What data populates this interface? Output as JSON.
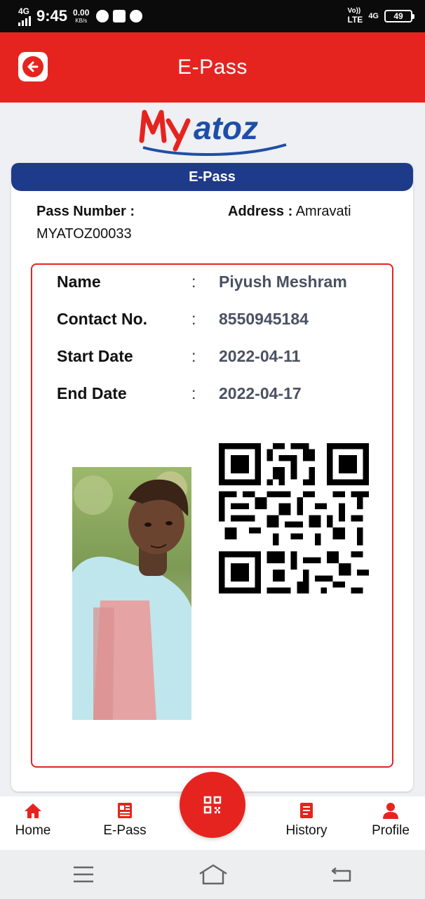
{
  "status_bar": {
    "network": "4G",
    "time": "9:45",
    "speed_value": "0.00",
    "speed_unit": "KB/s",
    "volte": "Vo))",
    "lte": "LTE",
    "signal_type": "4G",
    "battery": "49"
  },
  "app_bar": {
    "title": "E-Pass",
    "back_icon": "arrow-left-icon"
  },
  "logo": {
    "text_my": "MY",
    "text_atoz": "atoz",
    "brand_red": "#e52420",
    "brand_blue": "#1e4fa8"
  },
  "card": {
    "header": "E-Pass",
    "pass_number_label": "Pass Number :",
    "pass_number_value": "MYATOZ00033",
    "address_label": "Address :",
    "address_value": "Amravati"
  },
  "details": [
    {
      "label": "Name",
      "colon": ":",
      "value": "Piyush Meshram"
    },
    {
      "label": "Contact No.",
      "colon": ":",
      "value": "8550945184"
    },
    {
      "label": "Start Date",
      "colon": ":",
      "value": "2022-04-11"
    },
    {
      "label": "End Date",
      "colon": ":",
      "value": "2022-04-17"
    }
  ],
  "bottom_nav": {
    "home": "Home",
    "epass": "E-Pass",
    "history": "History",
    "profile": "Profile",
    "fab_icon": "qr-code-icon"
  },
  "colors": {
    "accent": "#e52420",
    "header_blue": "#1e3a8a",
    "value_gray": "#4a5161"
  }
}
